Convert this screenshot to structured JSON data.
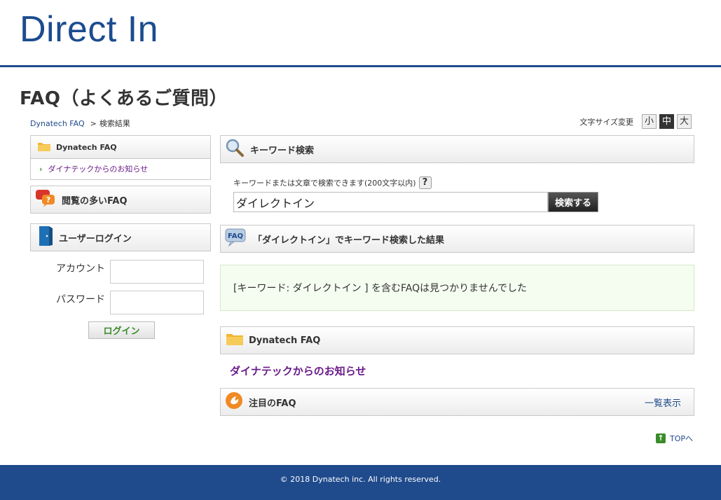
{
  "header": {
    "logo": "Direct In"
  },
  "page_title": "FAQ（よくあるご質問）",
  "breadcrumb": {
    "home": "Dynatech FAQ",
    "current": "検索結果"
  },
  "font_size": {
    "label": "文字サイズ変更",
    "small": "小",
    "medium": "中",
    "large": "大"
  },
  "sidebar": {
    "category_header": "Dynatech FAQ",
    "category_item": "ダイナテックからのお知らせ",
    "popular_header": "閲覧の多いFAQ",
    "login_header": "ユーザーログイン",
    "account_label": "アカウント",
    "password_label": "パスワード",
    "login_button": "ログイン"
  },
  "search": {
    "header": "キーワード検索",
    "hint": "キーワードまたは文章で検索できます(200文字以内)",
    "help_icon": "?",
    "value": "ダイレクトイン",
    "button": "検索する"
  },
  "results": {
    "header": "「ダイレクトイン」でキーワード検索した結果",
    "message": "[キーワード: ダイレクトイン ] を含むFAQは見つかりませんでした"
  },
  "category": {
    "header": "Dynatech FAQ",
    "link": "ダイナテックからのお知らせ"
  },
  "featured": {
    "header": "注目のFAQ",
    "more": "一覧表示"
  },
  "top_link": "TOPへ",
  "footer": "© 2018 Dynatech inc. All rights reserved.",
  "colors": {
    "brand": "#1f4a8c",
    "accent_green": "#3a8c2a",
    "link_purple": "#6a1b8a"
  }
}
